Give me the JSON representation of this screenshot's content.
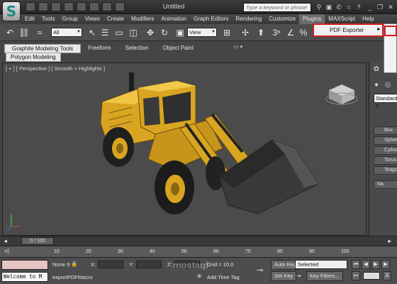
{
  "titlebar": {
    "title": "Untitled",
    "search_placeholder": "Type a keyword or phrase"
  },
  "menubar": {
    "items": [
      "Edit",
      "Tools",
      "Group",
      "Views",
      "Create",
      "Modifiers",
      "Animation",
      "Graph Editors",
      "Rendering",
      "Customize",
      "Plugins",
      "MAXScript",
      "Help"
    ],
    "active": "Plugins"
  },
  "plugins_menu": {
    "item": "PDF Exporter",
    "highlight_color": "#d01c1c"
  },
  "toolbar": {
    "selection_filter": "All",
    "reference_coord": "View"
  },
  "ribbon": {
    "tabs": [
      "Graphite Modeling Tools",
      "Freeform",
      "Selection",
      "Object Paint"
    ],
    "active_tab": "Graphite Modeling Tools",
    "sub_tab": "Polygon Modeling"
  },
  "viewport": {
    "label": "[ + ] [ Perspective ] [ Smooth + Highlights ]"
  },
  "command_panel": {
    "dropdown": "Standard P",
    "buttons": [
      "Box",
      "Sphere",
      "Cylinder",
      "Torus",
      "Teapot"
    ],
    "rollout": "Na"
  },
  "timeline": {
    "slider_text": "0 / 100",
    "ticks": [
      "10",
      "20",
      "30",
      "40",
      "50",
      "60",
      "70",
      "80",
      "90",
      "100"
    ]
  },
  "status": {
    "welcome": "Welcome to M",
    "selection": "None S",
    "x_label": "X:",
    "y_label": "Y:",
    "z_label": "Z:",
    "grid": "Grid = 10.0",
    "script": "exportPDFMacro",
    "add_time_tag": "Add Time Tag",
    "auto_key": "Auto Key",
    "set_key": "Set Key",
    "selected": "Selected",
    "key_filters": "Key Filters..."
  },
  "watermark": "mostaql",
  "colors": {
    "body_yellow": "#d9a521",
    "bucket": "#3a3a3a",
    "viewport_bg": "#4b4b4b"
  }
}
